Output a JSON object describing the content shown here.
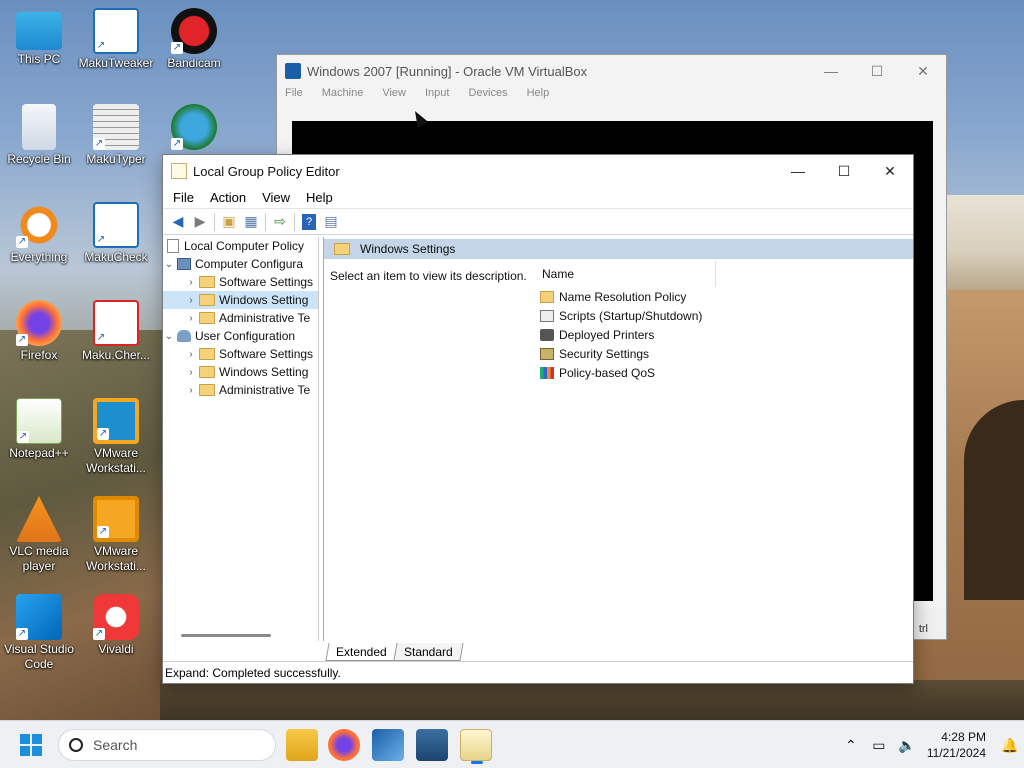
{
  "desktop": {
    "icons": [
      {
        "label": "This PC",
        "icon": "monitor-icon"
      },
      {
        "label": "MakuTweaker",
        "icon": "makutweaker-icon"
      },
      {
        "label": "Bandicam",
        "icon": "bandicam-icon"
      },
      {
        "label": "Recycle Bin",
        "icon": "recycle-bin-icon"
      },
      {
        "label": "MakuTyper",
        "icon": "makutyper-icon"
      },
      {
        "label": "",
        "icon": "idm-icon"
      },
      {
        "label": "Everything",
        "icon": "everything-icon"
      },
      {
        "label": "MakuCheck",
        "icon": "makucheck-icon"
      },
      {
        "label": "Firefox",
        "icon": "firefox-icon"
      },
      {
        "label": "Maku.Cher...",
        "icon": "makucherry-icon"
      },
      {
        "label": "Notepad++",
        "icon": "notepadpp-icon"
      },
      {
        "label": "VMware Workstati...",
        "icon": "vmware-icon"
      },
      {
        "label": "VLC media player",
        "icon": "vlc-icon"
      },
      {
        "label": "VMware Workstati...",
        "icon": "vmware-icon"
      },
      {
        "label": "Visual Studio Code",
        "icon": "vscode-icon"
      },
      {
        "label": "Vivaldi",
        "icon": "vivaldi-icon"
      }
    ]
  },
  "vbox": {
    "title": "Windows 2007 [Running] - Oracle VM VirtualBox",
    "menu": [
      "File",
      "Machine",
      "View",
      "Input",
      "Devices",
      "Help"
    ],
    "status_tail": "trl"
  },
  "gpe": {
    "title": "Local Group Policy Editor",
    "menu": [
      "File",
      "Action",
      "View",
      "Help"
    ],
    "tree": {
      "root": "Local Computer Policy",
      "computer": "Computer Configura",
      "computer_children": [
        "Software Settings",
        "Windows Setting",
        "Administrative Te"
      ],
      "user": "User Configuration",
      "user_children": [
        "Software Settings",
        "Windows Setting",
        "Administrative Te"
      ]
    },
    "header": "Windows Settings",
    "description": "Select an item to view its description.",
    "column_name": "Name",
    "items": [
      {
        "label": "Name Resolution Policy",
        "icon": "folder-icon"
      },
      {
        "label": "Scripts (Startup/Shutdown)",
        "icon": "script-icon"
      },
      {
        "label": "Deployed Printers",
        "icon": "printer-icon"
      },
      {
        "label": "Security Settings",
        "icon": "security-icon"
      },
      {
        "label": "Policy-based QoS",
        "icon": "qos-icon"
      }
    ],
    "tabs": [
      "Extended",
      "Standard"
    ],
    "status": "Expand:  Completed successfully."
  },
  "taskbar": {
    "search_placeholder": "Search",
    "apps": [
      "file-explorer-icon",
      "firefox-icon",
      "virtualbox-icon",
      "vm-window-icon",
      "notepad-icon"
    ],
    "time": "4:28 PM",
    "date": "11/21/2024"
  },
  "colors": {
    "selection": "#cce4f7",
    "header_band": "#c3d5e6",
    "accent": "#1a73e8"
  }
}
